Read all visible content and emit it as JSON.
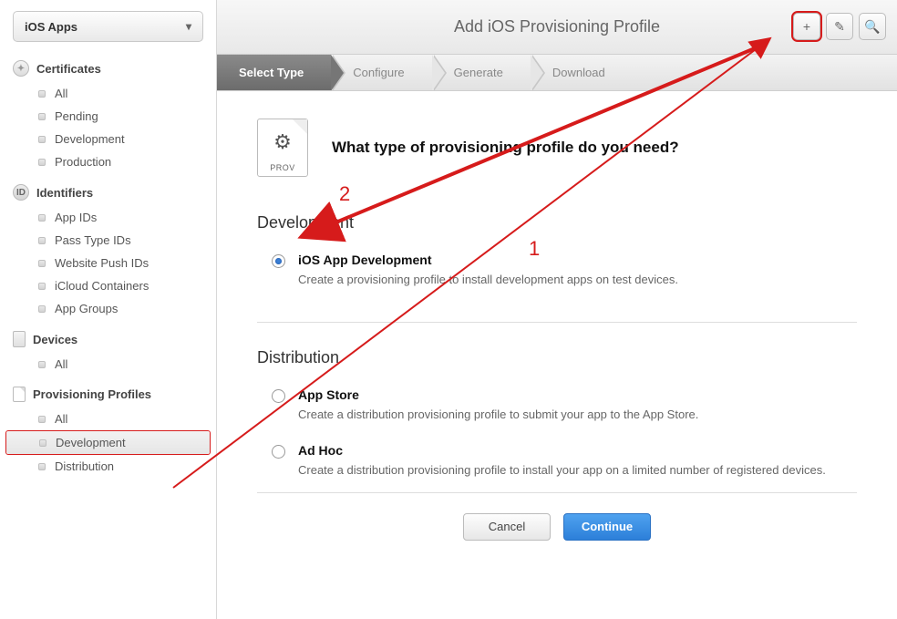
{
  "sidebar": {
    "selector_label": "iOS Apps",
    "sections": [
      {
        "title": "Certificates",
        "icon": "cert",
        "items": [
          {
            "label": "All"
          },
          {
            "label": "Pending"
          },
          {
            "label": "Development"
          },
          {
            "label": "Production"
          }
        ]
      },
      {
        "title": "Identifiers",
        "icon": "id",
        "items": [
          {
            "label": "App IDs"
          },
          {
            "label": "Pass Type IDs"
          },
          {
            "label": "Website Push IDs"
          },
          {
            "label": "iCloud Containers"
          },
          {
            "label": "App Groups"
          }
        ]
      },
      {
        "title": "Devices",
        "icon": "dev",
        "items": [
          {
            "label": "All"
          }
        ]
      },
      {
        "title": "Provisioning Profiles",
        "icon": "prov",
        "items": [
          {
            "label": "All"
          },
          {
            "label": "Development",
            "selected": true,
            "highlighted": true
          },
          {
            "label": "Distribution"
          }
        ]
      }
    ]
  },
  "header": {
    "title": "Add iOS Provisioning Profile",
    "actions": {
      "add": "+",
      "edit": "✎",
      "search": "🔍"
    }
  },
  "steps": [
    {
      "label": "Select Type",
      "active": true
    },
    {
      "label": "Configure"
    },
    {
      "label": "Generate"
    },
    {
      "label": "Download"
    }
  ],
  "intro": {
    "icon_label": "PROV",
    "question": "What type of provisioning profile do you need?"
  },
  "groups": [
    {
      "title": "Development",
      "options": [
        {
          "title": "iOS App Development",
          "desc": "Create a provisioning profile to install development apps on test devices.",
          "checked": true
        }
      ]
    },
    {
      "title": "Distribution",
      "options": [
        {
          "title": "App Store",
          "desc": "Create a distribution provisioning profile to submit your app to the App Store.",
          "checked": false
        },
        {
          "title": "Ad Hoc",
          "desc": "Create a distribution provisioning profile to install your app on a limited number of registered devices.",
          "checked": false
        }
      ]
    }
  ],
  "footer": {
    "cancel": "Cancel",
    "continue": "Continue"
  },
  "annotations": {
    "label1": "1",
    "label2": "2"
  }
}
